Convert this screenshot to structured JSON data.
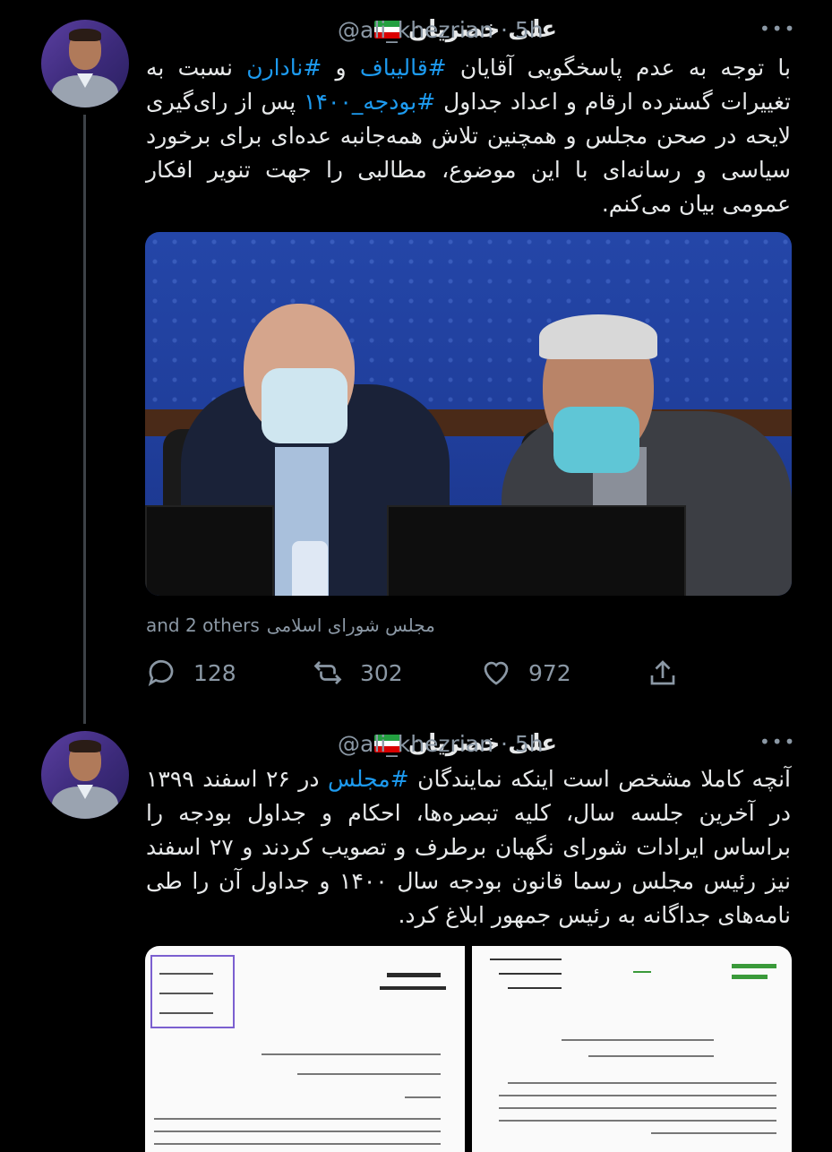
{
  "tweets": [
    {
      "name": "علی خضریان",
      "handle": "@ali_khezrian",
      "time": "5h",
      "text_segments": [
        {
          "t": "با توجه به عدم پاسخگویی آقایان ",
          "h": false
        },
        {
          "t": "#قالیباف",
          "h": true
        },
        {
          "t": " و ",
          "h": false
        },
        {
          "t": "#نادارن",
          "h": true
        },
        {
          "t": " نسبت به تغییرات گسترده ارقام و اعداد جداول ",
          "h": false
        },
        {
          "t": "#بودجه_۱۴۰۰",
          "h": true
        },
        {
          "t": " پس از رای‌گیری لایحه در صحن مجلس و همچنین تلاش همه‌جانبه عده‌ای برای برخورد سیاسی و رسانه‌ای با این موضوع، مطالبی را جهت تنویر افکار عمومی بیان می‌کنم.",
          "h": false
        }
      ],
      "tagged": "مجلس شورای اسلامی",
      "tagged_more": "and 2 others",
      "replies": "128",
      "retweets": "302",
      "likes": "972"
    },
    {
      "name": "علی خضریان",
      "handle": "@ali_khezrian",
      "time": "5h",
      "text_segments": [
        {
          "t": "آنچه کاملا مشخص است اینکه نمایندگان ",
          "h": false
        },
        {
          "t": "#مجلس",
          "h": true
        },
        {
          "t": " در ۲۶ اسفند ۱۳۹۹ در آخرین جلسه سال، کلیه تبصره‌ها، احکام و جداول بودجه را براساس ایرادات شورای نگهبان برطرف و تصویب کردند و ۲۷ اسفند نیز رئیس مجلس رسما قانون بودجه سال ۱۴۰۰ و جداول آن را طی نامه‌های جداگانه به رئیس جمهور ابلاغ کرد.",
          "h": false
        }
      ]
    }
  ],
  "more_glyph": "•••",
  "colors": {
    "link": "#1d9bf0",
    "muted": "#8b98a5",
    "text": "#e7e9ea",
    "bg": "#000000"
  },
  "icons": [
    "iran-flag-icon",
    "reply-icon",
    "retweet-icon",
    "like-icon",
    "share-icon",
    "more-icon"
  ]
}
